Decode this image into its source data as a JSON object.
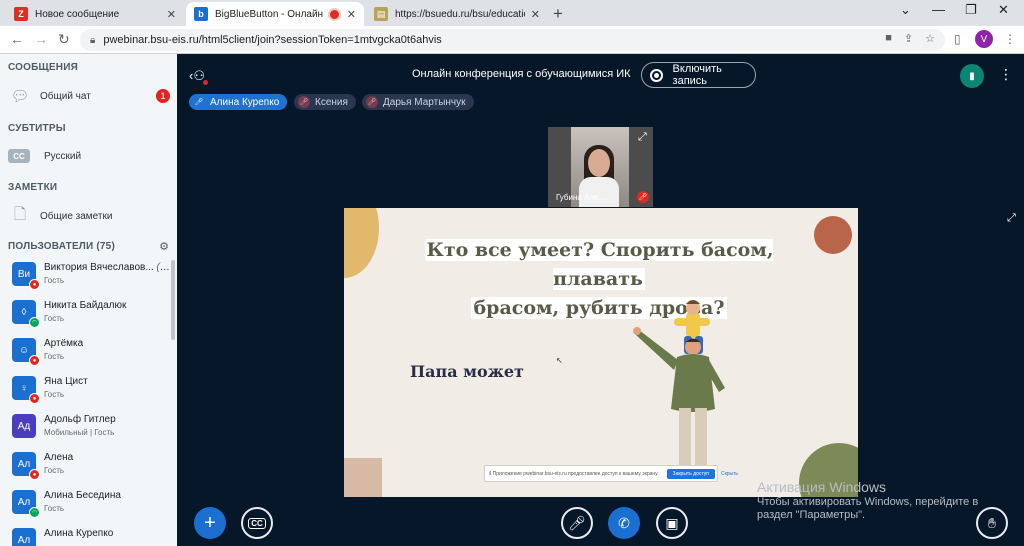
{
  "browser": {
    "tabs": [
      {
        "title": "Новое сообщение",
        "icon": "mail-favicon",
        "color": "#d93025"
      },
      {
        "title": "BigBlueButton - Онлайн конфе",
        "icon": "bbb-favicon",
        "color": "#1b6fd1"
      },
      {
        "title": "https://bsuedu.ru/bsu/education/sc",
        "icon": "doc-favicon",
        "color": "#b8a35b"
      }
    ],
    "url": "pwebinar.bsu-eis.ru/html5client/join?sessionToken=1mtvgcka0t6ahvis",
    "profile_letter": "V"
  },
  "sidebar": {
    "messages_title": "СООБЩЕНИЯ",
    "public_chat": {
      "label": "Общий чат",
      "unread": "1"
    },
    "captions_title": "СУБТИТРЫ",
    "captions_lang": {
      "badge": "CC",
      "label": "Русский"
    },
    "notes_title": "ЗАМЕТКИ",
    "shared_notes": "Общие заметки",
    "users_title": "ПОЛЬЗОВАТЕЛИ (75)",
    "users": [
      {
        "initials": "Ви",
        "name": "Виктория Вячеславов...",
        "you": "(Вы)",
        "role": "Гость",
        "color": "#1a6fd0",
        "mic": "muted"
      },
      {
        "initials": "◊",
        "name": "Никита Байдалюк",
        "you": "",
        "role": "Гость",
        "color": "#1a6fd0",
        "mic": "listen"
      },
      {
        "initials": "☺",
        "name": "Артёмка",
        "you": "",
        "role": "Гость",
        "color": "#1a6fd0",
        "mic": "muted"
      },
      {
        "initials": "♀",
        "name": "Яна Цист",
        "you": "",
        "role": "Гость",
        "color": "#1a6fd0",
        "mic": "muted"
      },
      {
        "initials": "Ад",
        "name": "Адольф Гитлер",
        "you": "",
        "role": "Мобильный | Гость",
        "color": "#4a3ebf",
        "mic": "none"
      },
      {
        "initials": "Ал",
        "name": "Алена",
        "you": "",
        "role": "Гость",
        "color": "#1a6fd0",
        "mic": "muted"
      },
      {
        "initials": "Ал",
        "name": "Алина Беседина",
        "you": "",
        "role": "Гость",
        "color": "#1a6fd0",
        "mic": "listen"
      },
      {
        "initials": "Ал",
        "name": "Алина Курепко",
        "you": "",
        "role": "",
        "color": "#1a6fd0",
        "mic": "none"
      }
    ]
  },
  "meeting": {
    "title": "Онлайн конференция с обучающимися ИК",
    "record_label": "Включить запись",
    "talkers": [
      {
        "name": "Алина Курепко",
        "state": "active"
      },
      {
        "name": "Ксения",
        "state": "muted"
      },
      {
        "name": "Дарья Мартынчук",
        "state": "muted"
      }
    ],
    "webcam_name": "Губина Але...",
    "slide": {
      "title_line1": "Кто все умеет? Спорить басом, плавать",
      "title_line2": "брасом, рубить дрова?",
      "subtitle": "Папа может",
      "share_text": "Приложение pwebinar.bsu-eis.ru предоставлен доступ к вашему экрану.",
      "share_button": "Закрыть доступ",
      "hide_button": "Скрыть"
    },
    "windows_activation_title": "Активация Windows",
    "windows_activation_text": "Чтобы активировать Windows, перейдите в раздел \"Параметры\"."
  }
}
